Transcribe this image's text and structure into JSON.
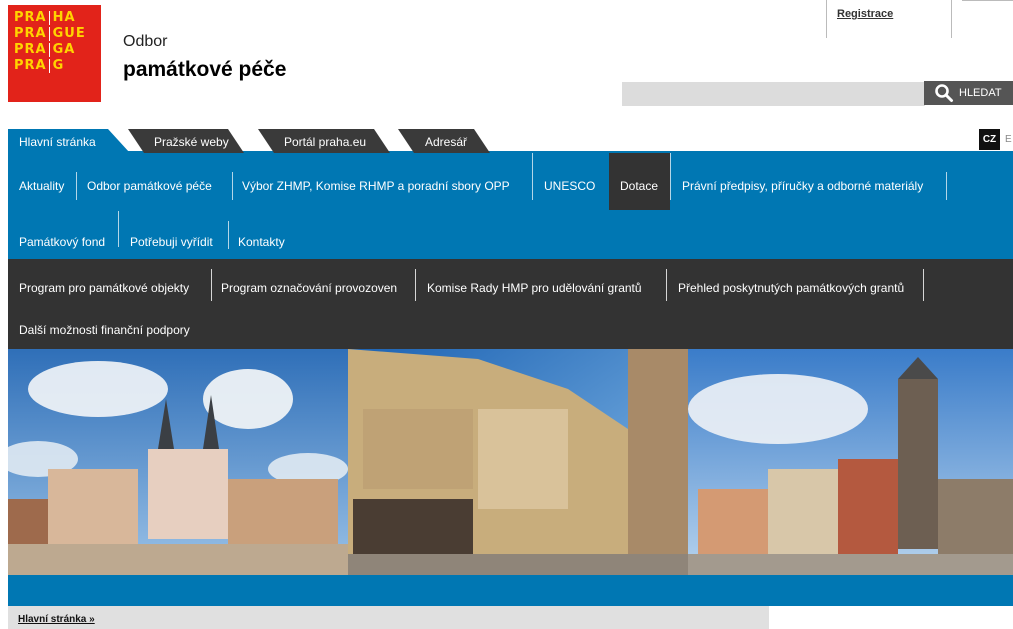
{
  "logo": {
    "rows": [
      {
        "left": "PRA",
        "right": "HA"
      },
      {
        "left": "PRA",
        "right": "GUE"
      },
      {
        "left": "PRA",
        "right": "GA"
      },
      {
        "left": "PRA",
        "right": "G"
      }
    ]
  },
  "header": {
    "dept_line1": "Odbor",
    "dept_line2": "památkové péče",
    "registration_link": "Registrace"
  },
  "search": {
    "placeholder": "",
    "button_label": "HLEDAT",
    "icon": "search-icon"
  },
  "tabs": [
    {
      "label": "Hlavní stránka",
      "active": true
    },
    {
      "label": "Pražské weby",
      "active": false
    },
    {
      "label": "Portál praha.eu",
      "active": false
    },
    {
      "label": "Adresář",
      "active": false
    }
  ],
  "language": {
    "current": "CZ",
    "other": "E"
  },
  "main_nav": {
    "items": [
      {
        "label": "Aktuality"
      },
      {
        "label": "Odbor památkové péče"
      },
      {
        "label": "Výbor ZHMP, Komise RHMP a poradní sbory OPP"
      },
      {
        "label": "UNESCO"
      },
      {
        "label": "Dotace",
        "active": true
      },
      {
        "label": "Právní předpisy, příručky a odborné materiály"
      },
      {
        "label": "Památkový fond"
      },
      {
        "label": "Potřebuji vyřídit"
      },
      {
        "label": "Kontakty"
      }
    ]
  },
  "sub_nav": {
    "items": [
      {
        "label": "Program pro památkové objekty"
      },
      {
        "label": "Program označování provozoven"
      },
      {
        "label": "Komise Rady HMP pro udělování grantů"
      },
      {
        "label": "Přehled poskytnutých památkových grantů"
      },
      {
        "label": "Další možnosti finanční podpory"
      }
    ]
  },
  "breadcrumb": {
    "label": "Hlavní stránka »"
  },
  "colors": {
    "brand_red": "#e2231a",
    "brand_yellow": "#ffd400",
    "nav_blue": "#0077b3",
    "dark_bar": "#333333",
    "tab_dark": "#3a3a3a"
  }
}
